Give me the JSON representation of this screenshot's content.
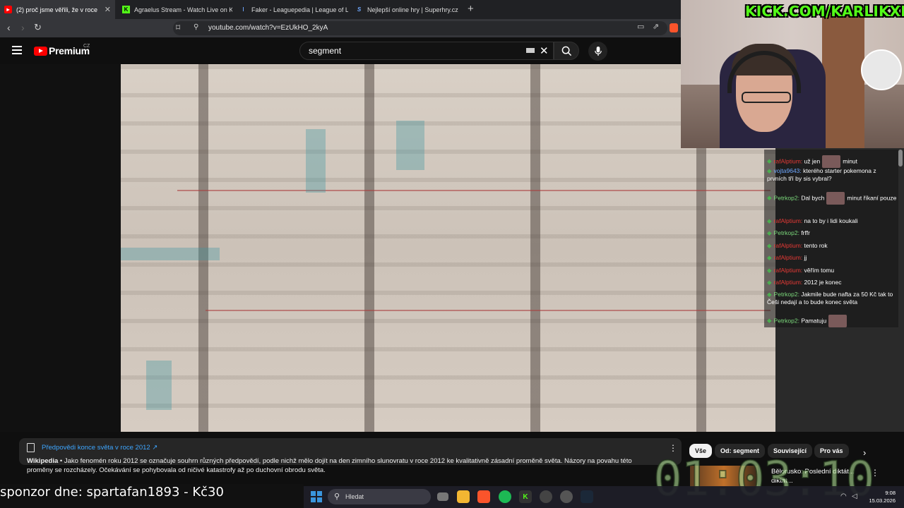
{
  "browser": {
    "tabs": [
      {
        "label": "(2) proč jsme věřili, že v roce",
        "favicon": "youtube-icon",
        "active": true
      },
      {
        "label": "Agraelus Stream - Watch Live on Kick",
        "favicon": "kick-icon"
      },
      {
        "label": "Faker - Leaguepedia | League of Lege",
        "favicon": "leaguepedia-icon"
      },
      {
        "label": "Nejlepší online hry | Superhry.cz",
        "favicon": "superhry-icon"
      }
    ],
    "new_tab": "+",
    "url": "youtube.com/watch?v=EzUkHO_2kyA"
  },
  "youtube": {
    "logo_text": "Premium",
    "region": "CZ",
    "search_value": "segment"
  },
  "overlay": {
    "kick_tag": "KICK.COM/KARLIKXD",
    "timer": "01:03:10",
    "sponsor": "sponzor dne: spartafan1893 - Kč30"
  },
  "chat": [
    {
      "user": "rafAlptium:",
      "text": "už jen",
      "emote": true,
      "after": "minut",
      "color": "red"
    },
    {
      "user": "vojta9643:",
      "text": "kterého starter pokemona z prvních tří by sis vybral?",
      "color": "blue"
    },
    {
      "user": "Petrkop2:",
      "text": "Dal bych",
      "emote": true,
      "after": "minut říkaní pouze",
      "color": "green"
    },
    {
      "user": "rafAlptium:",
      "text": "na to by i lidi koukali",
      "color": "red"
    },
    {
      "user": "Petrkop2:",
      "text": "frffr",
      "color": "green"
    },
    {
      "user": "rafAlptium:",
      "text": "tento rok",
      "color": "red"
    },
    {
      "user": "rafAlptium:",
      "text": "jj",
      "color": "red"
    },
    {
      "user": "rafAlptium:",
      "text": "věřím tomu",
      "color": "red"
    },
    {
      "user": "rafAlptium:",
      "text": "2012 je konec",
      "color": "red"
    },
    {
      "user": "Petrkop2:",
      "text": "Jakmile bude nafta za 50 Kč tak to Češi nedají a to bude konec světa",
      "color": "green"
    },
    {
      "user": "Petrkop2:",
      "text": "Pamatuju",
      "emote": true,
      "color": "green"
    }
  ],
  "info_panel": {
    "title": "Předpovědi konce světa v roce 2012 ↗",
    "source": "Wikipedia",
    "text": " • Jako fenomén roku 2012 se označuje souhrn různých předpovědí, podle nichž mělo dojít na den zimního slunovratu v roce 2012 ke kvalitativně zásadní proměně světa. Názory na povahu této proměny se rozcházely. Očekávání se pohybovala od ničivé katastrofy až po duchovní obrodu světa."
  },
  "chips": [
    "Vše",
    "Od: segment",
    "Související",
    "Pro vás"
  ],
  "recommendation": {
    "title": "Bělorusko: Poslední diktát...",
    "title_line2": "diktat..."
  },
  "taskbar": {
    "search_placeholder": "Hledat",
    "time": "9:08",
    "date": "15.03.2026"
  }
}
